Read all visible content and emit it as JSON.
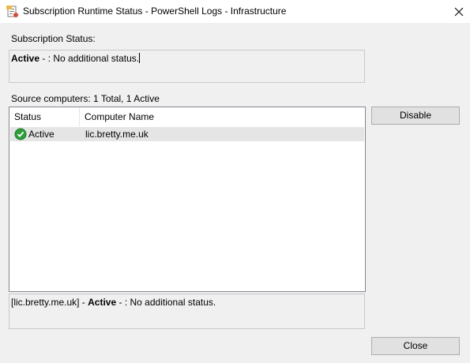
{
  "window": {
    "title": "Subscription Runtime Status - PowerShell Logs - Infrastructure",
    "close_icon": "close-icon"
  },
  "subscription_status": {
    "label": "Subscription Status:",
    "state": "Active",
    "message": " - : No additional status."
  },
  "source_computers": {
    "label": "Source computers: 1 Total, 1 Active",
    "columns": [
      "Status",
      "Computer Name"
    ],
    "rows": [
      {
        "status": "Active",
        "status_icon": "check-circle-icon",
        "computer_name": "lic.bretty.me.uk"
      }
    ]
  },
  "detail": {
    "computer": "[lic.bretty.me.uk]",
    "separator": " - ",
    "state": "Active",
    "message": " - : No additional status."
  },
  "buttons": {
    "disable": "Disable",
    "close": "Close"
  },
  "colors": {
    "check_green": "#2e9e3a",
    "selected_row": "#e5e5e5"
  }
}
